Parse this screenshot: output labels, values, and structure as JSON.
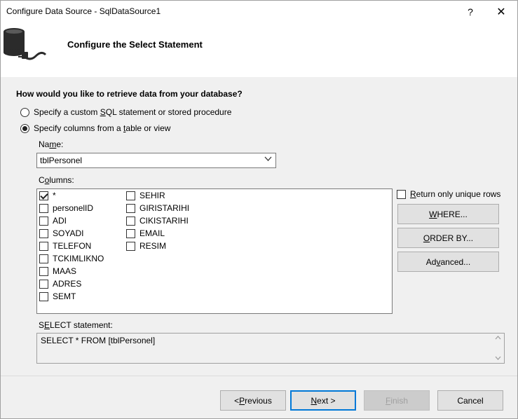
{
  "window": {
    "title": "Configure Data Source - SqlDataSource1",
    "help_glyph": "?",
    "close_glyph": "✕"
  },
  "header": {
    "heading": "Configure the Select Statement",
    "icon": "database-plug-icon"
  },
  "main": {
    "question": "How would you like to retrieve data from your database?",
    "radio_options": [
      {
        "pre": "Specify a custom ",
        "accel": "S",
        "post": "QL statement or stored procedure",
        "checked": false
      },
      {
        "pre": "Specify columns from a ",
        "accel": "t",
        "post": "able or view",
        "checked": true
      }
    ],
    "name_label": {
      "pre": "Na",
      "accel": "m",
      "post": "e:"
    },
    "name_value": "tblPersonel",
    "columns_label": {
      "pre": "C",
      "accel": "o",
      "post": "lumns:"
    },
    "columns": [
      {
        "label": "*",
        "checked": true
      },
      {
        "label": "personelID",
        "checked": false
      },
      {
        "label": "ADI",
        "checked": false
      },
      {
        "label": "SOYADI",
        "checked": false
      },
      {
        "label": "TELEFON",
        "checked": false
      },
      {
        "label": "TCKIMLIKNO",
        "checked": false
      },
      {
        "label": "MAAS",
        "checked": false
      },
      {
        "label": "ADRES",
        "checked": false
      },
      {
        "label": "SEMT",
        "checked": false
      },
      {
        "label": "SEHIR",
        "checked": false
      },
      {
        "label": "GIRISTARIHI",
        "checked": false
      },
      {
        "label": "CIKISTARIHI",
        "checked": false
      },
      {
        "label": "EMAIL",
        "checked": false
      },
      {
        "label": "RESIM",
        "checked": false
      }
    ],
    "unique_rows": {
      "pre": "",
      "accel": "R",
      "post": "eturn only unique rows",
      "checked": false
    },
    "side_buttons": {
      "where": {
        "pre": "",
        "accel": "W",
        "post": "HERE..."
      },
      "order_by": {
        "pre": "",
        "accel": "O",
        "post": "RDER BY..."
      },
      "advanced": {
        "pre": "Ad",
        "accel": "v",
        "post": "anced..."
      }
    },
    "select_label": {
      "pre": "S",
      "accel": "E",
      "post": "LECT statement:"
    },
    "select_statement": "SELECT * FROM [tblPersonel]"
  },
  "footer": {
    "previous": {
      "pre": "< ",
      "accel": "P",
      "post": "revious"
    },
    "next": {
      "pre": "",
      "accel": "N",
      "post": "ext >"
    },
    "finish": {
      "pre": "",
      "accel": "F",
      "post": "inish"
    },
    "cancel": "Cancel"
  },
  "colors": {
    "accent": "#0078d7",
    "panel": "#f0f0f0",
    "button": "#e1e1e1"
  }
}
